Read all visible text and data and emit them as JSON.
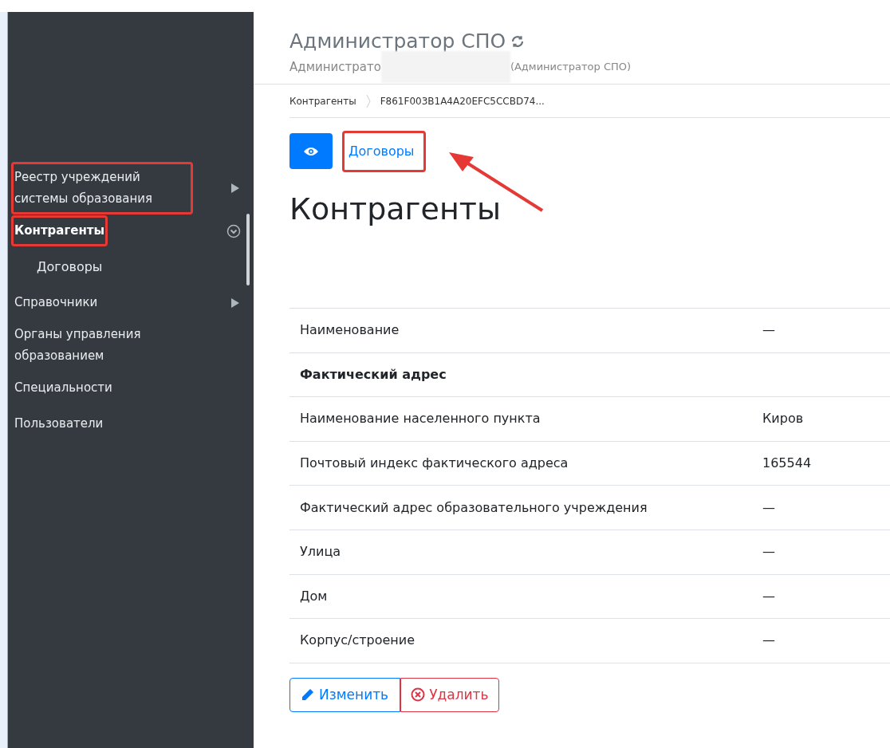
{
  "header": {
    "title": "Администратор СПО",
    "subtitle_start": "Администрато",
    "subtitle_end": "(Администратор СПО)"
  },
  "sidebar": {
    "items": [
      {
        "label": "Реестр учреждений системы образования",
        "selected": false,
        "highlighted": true,
        "kind": "submenu"
      },
      {
        "label": "Контрагенты",
        "selected": true,
        "highlighted": true,
        "kind": "expanded",
        "children": [
          {
            "label": "Договоры",
            "selected": false
          }
        ]
      },
      {
        "label": "Справочники",
        "selected": false,
        "highlighted": false,
        "kind": "submenu"
      },
      {
        "label": "Органы управления образованием",
        "selected": false,
        "highlighted": false,
        "kind": "plain"
      },
      {
        "label": "Специальности",
        "selected": false,
        "highlighted": false,
        "kind": "plain"
      },
      {
        "label": "Пользователи",
        "selected": false,
        "highlighted": false,
        "kind": "plain"
      }
    ]
  },
  "breadcrumb": [
    "Контрагенты",
    "F861F003B1A4A20EFC5CCBD74..."
  ],
  "toolbar": {
    "link": "Договоры",
    "link_highlighted": true
  },
  "page_title": "Контрагенты",
  "table": {
    "rows": [
      {
        "kind": "field",
        "label": "Наименование",
        "value": "—"
      },
      {
        "kind": "section",
        "label": "Фактический адрес"
      },
      {
        "kind": "field",
        "label": "Наименование населенного пункта",
        "value": "Киров"
      },
      {
        "kind": "field",
        "label": "Почтовый индекс фактического адреса",
        "value": "165544"
      },
      {
        "kind": "field",
        "label": "Фактический адрес образовательного учреждения",
        "value": "—"
      },
      {
        "kind": "field",
        "label": "Улица",
        "value": "—"
      },
      {
        "kind": "field",
        "label": "Дом",
        "value": "—"
      },
      {
        "kind": "field",
        "label": "Корпус/строение",
        "value": "—"
      }
    ]
  },
  "actions": {
    "edit": "Изменить",
    "delete": "Удалить"
  }
}
